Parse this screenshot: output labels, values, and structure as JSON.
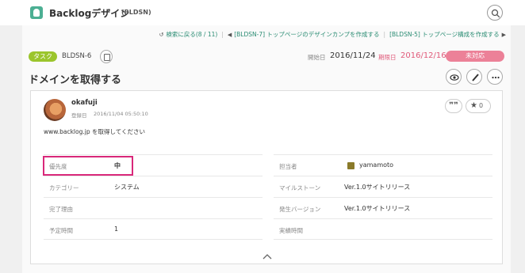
{
  "header": {
    "project_name": "Backlogデザイン",
    "project_key": "(BLDSN)",
    "search_icon": "search-icon"
  },
  "nav": {
    "back_to_search": "検索に戻る(8 / 11)",
    "prev_issue": "[BLDSN-7] トップページのデザインカンプを作成する",
    "next_issue": "[BLDSN-5] トップページ構成を作成する"
  },
  "issue": {
    "type": "タスク",
    "key": "BLDSN-6",
    "start_label": "開始日",
    "start_date": "2016/11/24",
    "due_label": "期限日",
    "due_date": "2016/12/16",
    "status": "未対応",
    "title": "ドメインを取得する"
  },
  "detail": {
    "author": "okafuji",
    "registered_label": "登録日",
    "registered_date": "2016/11/04 05:50:10",
    "description": "www.backlog.jp を取得してください",
    "quote_glyph": "❞❞",
    "star_count": "0"
  },
  "properties": {
    "left": [
      {
        "label": "優先度",
        "value": "中"
      },
      {
        "label": "カテゴリー",
        "value": "システム"
      },
      {
        "label": "完了理由",
        "value": ""
      },
      {
        "label": "予定時間",
        "value": "1"
      }
    ],
    "right": [
      {
        "label": "担当者",
        "value": "yamamoto"
      },
      {
        "label": "マイルストーン",
        "value": "Ver.1.0サイトリリース"
      },
      {
        "label": "発生バージョン",
        "value": "Ver.1.0サイトリリース"
      },
      {
        "label": "実績時間",
        "value": ""
      }
    ]
  },
  "colors": {
    "type_badge": "#9bc52c",
    "status_badge": "#ec8198",
    "link": "#2a8c73",
    "due_date": "#e05a7a",
    "highlight": "#d9287a"
  }
}
